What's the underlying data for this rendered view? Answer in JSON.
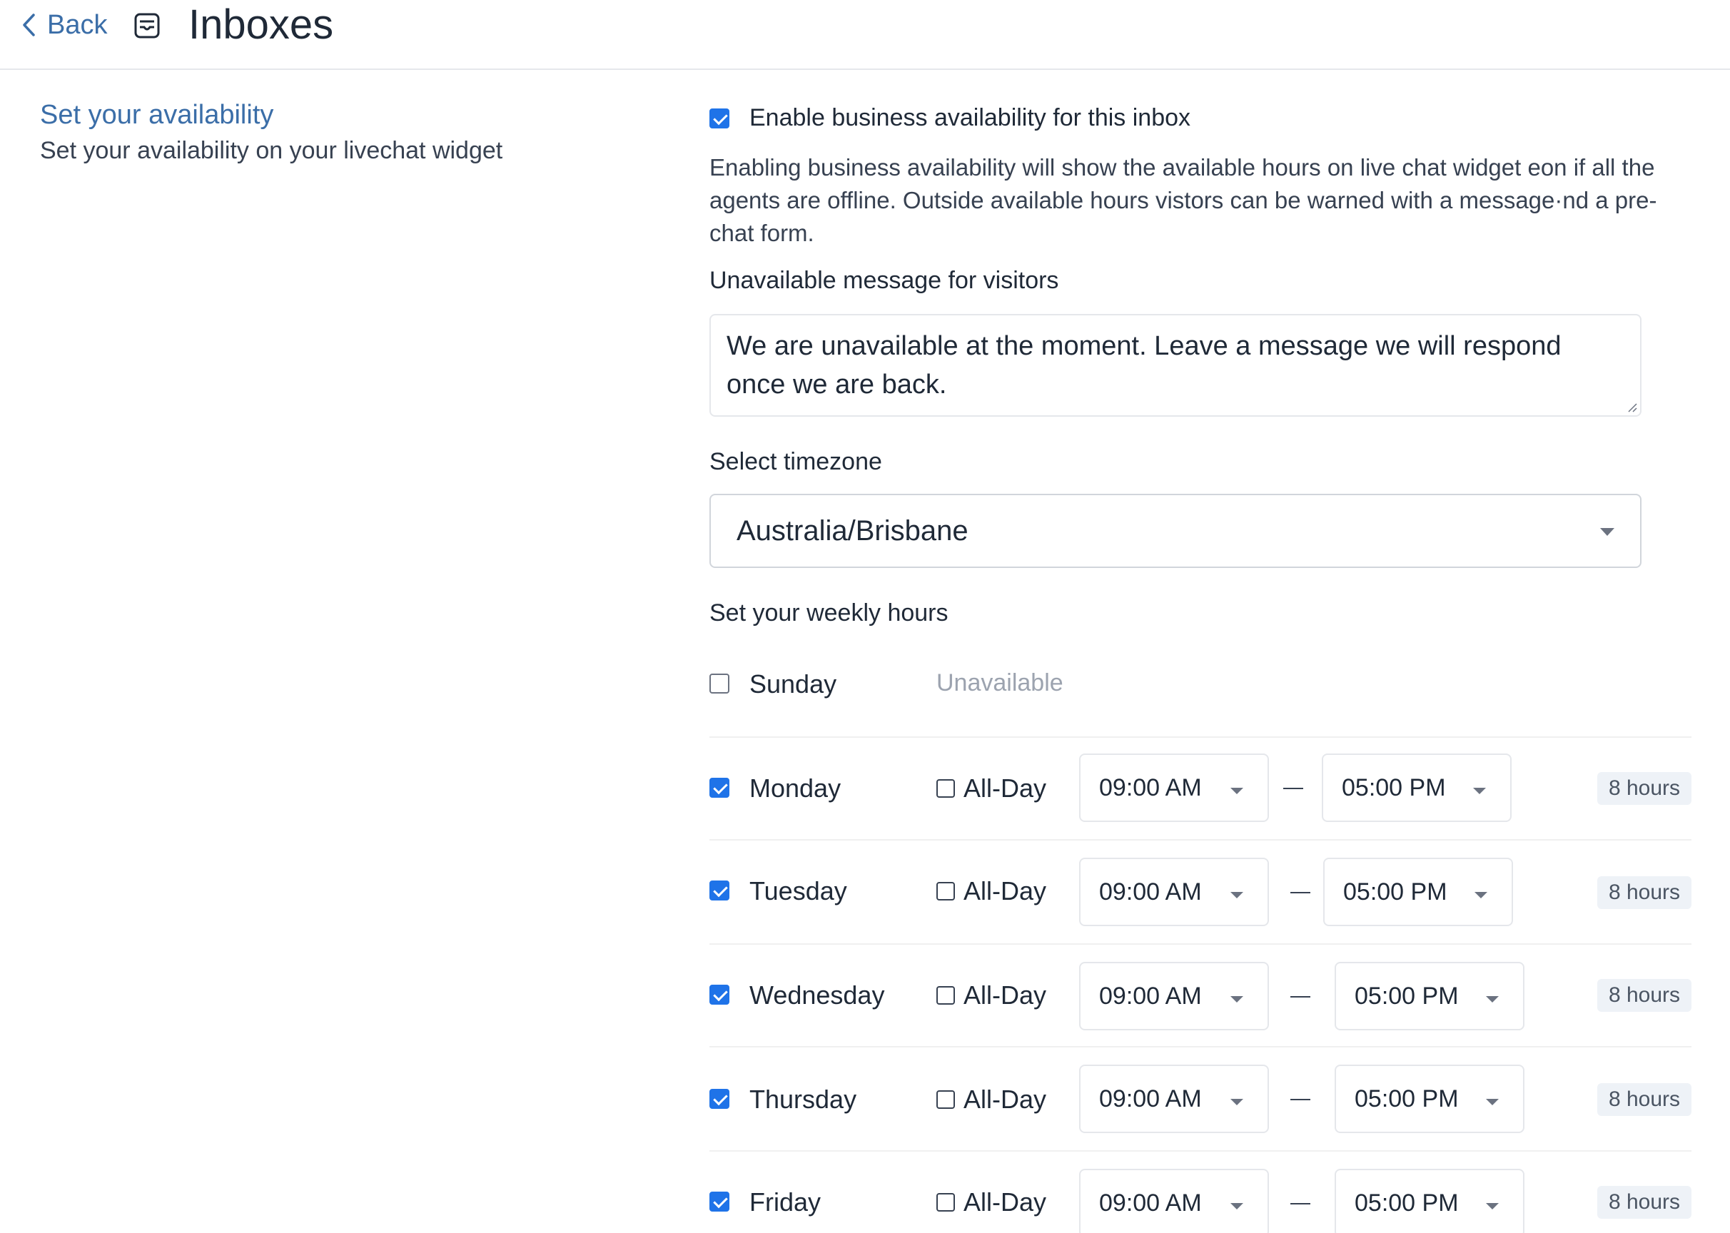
{
  "header": {
    "back_label": "Back",
    "title": "Inboxes"
  },
  "left": {
    "title": "Set your availability",
    "subtitle": "Set your availability on your livechat widget"
  },
  "availability": {
    "enabled": true,
    "enable_label": "Enable business availability for this inbox",
    "description": "Enabling business availability will show the available hours on live chat widget eon if all the agents are offline. Outside available hours vistors can be warned with a message·nd a pre-chat form.",
    "message_label": "Unavailable message for visitors",
    "message_value": "We are unavailable at the moment. Leave a message we will respond once we are back.",
    "timezone_label": "Select timezone",
    "timezone_value": "Australia/Brisbane",
    "weekly_label": "Set your weekly hours"
  },
  "days": [
    {
      "name": "Sunday",
      "enabled": false,
      "unavailable_label": "Unavailable"
    },
    {
      "name": "Monday",
      "enabled": true,
      "allday_label": "All-Day",
      "from": "09:00 AM",
      "to": "05:00 PM",
      "hours": "8 hours"
    },
    {
      "name": "Tuesday",
      "enabled": true,
      "allday_label": "All-Day",
      "from": "09:00 AM",
      "to": "05:00 PM",
      "hours": "8 hours"
    },
    {
      "name": "Wednesday",
      "enabled": true,
      "allday_label": "All-Day",
      "from": "09:00 AM",
      "to": "05:00 PM",
      "hours": "8 hours"
    },
    {
      "name": "Thursday",
      "enabled": true,
      "allday_label": "All-Day",
      "from": "09:00 AM",
      "to": "05:00 PM",
      "hours": "8 hours"
    },
    {
      "name": "Friday",
      "enabled": true,
      "allday_label": "All-Day",
      "from": "09:00 AM",
      "to": "05:00 PM",
      "hours": "8 hours"
    }
  ],
  "colors": {
    "accent": "#1f73e8",
    "link": "#3b6ea8"
  }
}
